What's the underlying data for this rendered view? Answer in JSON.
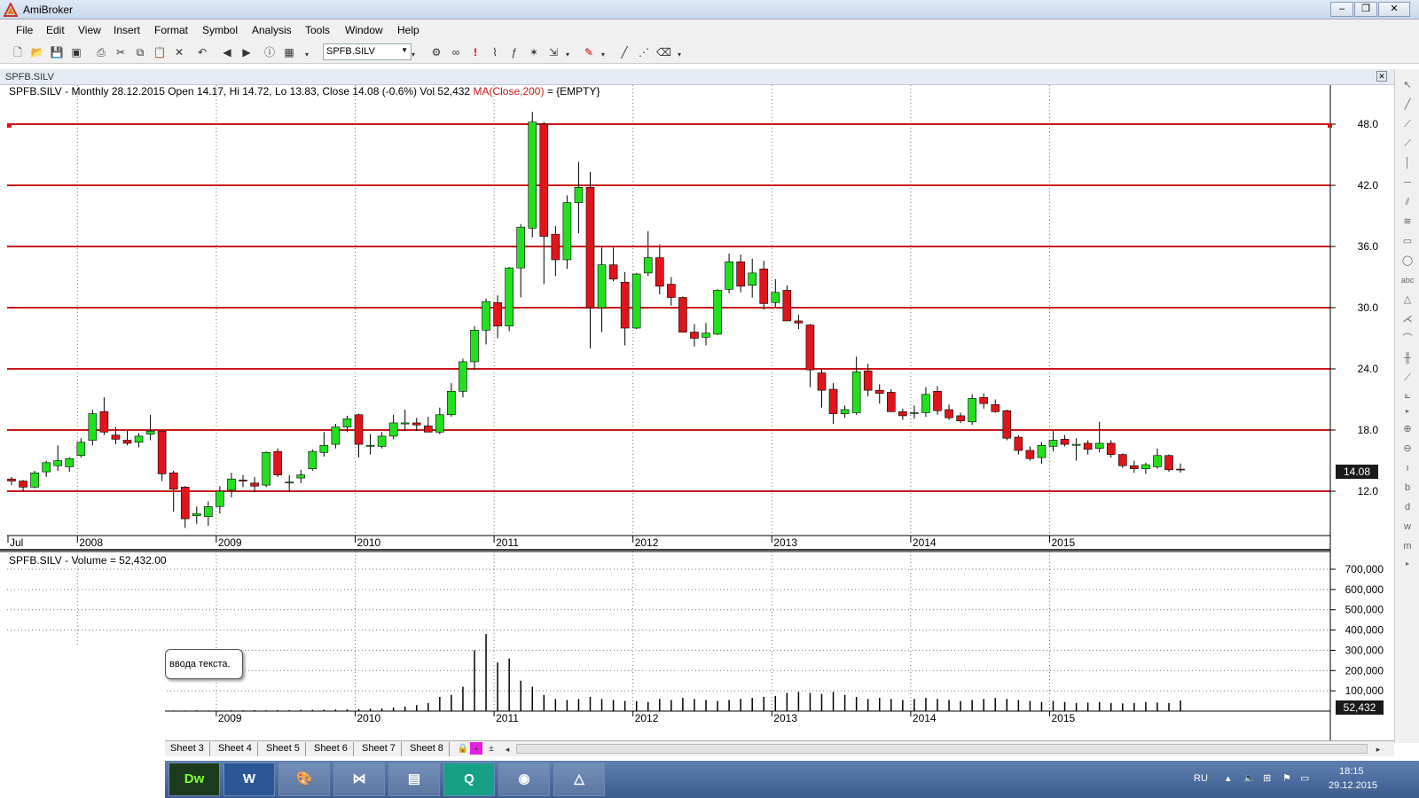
{
  "app": {
    "title": "AmiBroker"
  },
  "window_controls": {
    "minimize": "–",
    "restore": "❐",
    "close": "✕"
  },
  "menu": [
    "File",
    "Edit",
    "View",
    "Insert",
    "Format",
    "Symbol",
    "Analysis",
    "Tools",
    "Window",
    "Help"
  ],
  "toolbar": {
    "symbol": "SPFB.SILV"
  },
  "chart_window": {
    "title": "SPFB.SILV"
  },
  "price_pane": {
    "header_main": "SPFB.SILV - Monthly 28.12.2015 Open 14.17, Hi 14.72, Lo 13.83, Close 14.08 (-0.6%) Vol 52,432",
    "header_ma": "MA(Close,200)",
    "header_tail": " = {EMPTY}",
    "last_price_label": "14.08"
  },
  "volume_pane": {
    "header": "SPFB.SILV - Volume = 52,432.00",
    "last_volume_label": "52,432"
  },
  "tooltip": {
    "text": "ввода текста."
  },
  "sheets": [
    "Sheet 3",
    "Sheet 4",
    "Sheet 5",
    "Sheet 6",
    "Sheet 7",
    "Sheet 8"
  ],
  "taskbar": {
    "apps": [
      "Dw",
      "W",
      "",
      "",
      "",
      "Q",
      "",
      ""
    ],
    "language": "RU",
    "time": "18:15",
    "date": "29.12.2015"
  },
  "colors": {
    "up": "#22e01e",
    "down": "#e0141a",
    "hline": "#c8181c",
    "accent_bg": "#1a1a1a"
  },
  "chart_data": [
    {
      "type": "candlestick",
      "title": "SPFB.SILV - Monthly",
      "x_ticks": [
        "Jul",
        "2008",
        "2009",
        "2010",
        "2011",
        "2012",
        "2013",
        "2014",
        "2015"
      ],
      "y_ticks": [
        "48.0",
        "42.0",
        "36.0",
        "30.0",
        "24.0",
        "18.0",
        "12.0"
      ],
      "ylim": [
        6.0,
        50.0
      ],
      "horizontal_lines": [
        48.0,
        42.0,
        36.0,
        30.0,
        24.0,
        18.0,
        12.0
      ],
      "candles": [
        [
          13.2,
          13.4,
          12.6,
          13.0
        ],
        [
          13.0,
          13.1,
          12.0,
          12.4
        ],
        [
          12.4,
          14.0,
          12.3,
          13.8
        ],
        [
          13.9,
          15.0,
          13.4,
          14.8
        ],
        [
          14.5,
          16.5,
          14.0,
          15.0
        ],
        [
          14.4,
          15.3,
          13.9,
          15.2
        ],
        [
          15.5,
          17.2,
          15.3,
          16.8
        ],
        [
          17.0,
          20.0,
          16.5,
          19.6
        ],
        [
          19.8,
          21.2,
          17.5,
          17.8
        ],
        [
          17.5,
          18.3,
          16.6,
          17.1
        ],
        [
          17.0,
          18.0,
          16.5,
          16.7
        ],
        [
          16.8,
          17.7,
          16.3,
          17.4
        ],
        [
          17.6,
          19.5,
          17.0,
          17.9
        ],
        [
          17.9,
          18.0,
          13.0,
          13.7
        ],
        [
          13.8,
          14.0,
          10.0,
          12.2
        ],
        [
          12.4,
          12.5,
          8.4,
          9.3
        ],
        [
          9.6,
          10.5,
          8.8,
          9.8
        ],
        [
          9.5,
          11.0,
          8.6,
          10.5
        ],
        [
          10.5,
          12.5,
          9.8,
          12.0
        ],
        [
          12.1,
          13.8,
          11.4,
          13.2
        ],
        [
          13.1,
          13.6,
          12.4,
          13.0
        ],
        [
          12.8,
          13.4,
          11.9,
          12.5
        ],
        [
          12.6,
          15.9,
          12.4,
          15.8
        ],
        [
          15.9,
          16.2,
          13.4,
          13.6
        ],
        [
          12.8,
          13.6,
          11.9,
          12.9
        ],
        [
          13.3,
          14.1,
          12.8,
          13.6
        ],
        [
          14.2,
          16.1,
          14.0,
          15.9
        ],
        [
          15.8,
          17.8,
          15.4,
          16.5
        ],
        [
          16.6,
          18.6,
          16.2,
          18.3
        ],
        [
          18.3,
          19.4,
          17.8,
          19.1
        ],
        [
          19.5,
          19.6,
          15.3,
          16.6
        ],
        [
          16.4,
          17.6,
          15.6,
          16.5
        ],
        [
          16.4,
          17.8,
          16.2,
          17.4
        ],
        [
          17.4,
          19.5,
          17.1,
          18.7
        ],
        [
          18.6,
          20.0,
          17.9,
          18.7
        ],
        [
          18.7,
          19.2,
          17.9,
          18.5
        ],
        [
          18.4,
          19.3,
          17.8,
          17.8
        ],
        [
          17.8,
          20.2,
          17.6,
          19.5
        ],
        [
          19.5,
          22.6,
          19.3,
          21.8
        ],
        [
          21.8,
          25.0,
          21.2,
          24.7
        ],
        [
          24.7,
          28.2,
          23.9,
          27.8
        ],
        [
          27.8,
          30.9,
          26.4,
          30.6
        ],
        [
          30.5,
          31.2,
          27.0,
          28.2
        ],
        [
          28.2,
          34.0,
          27.7,
          33.9
        ],
        [
          33.9,
          38.2,
          31.0,
          37.9
        ],
        [
          37.8,
          49.2,
          36.9,
          48.2
        ],
        [
          48.0,
          48.2,
          32.3,
          37.0
        ],
        [
          37.2,
          38.0,
          33.1,
          34.7
        ],
        [
          34.7,
          41.0,
          33.8,
          40.3
        ],
        [
          40.3,
          44.3,
          37.3,
          41.8
        ],
        [
          41.8,
          43.3,
          26.0,
          30.0
        ],
        [
          30.0,
          35.9,
          27.6,
          34.2
        ],
        [
          34.2,
          35.9,
          32.6,
          32.8
        ],
        [
          32.5,
          33.5,
          26.3,
          28.0
        ],
        [
          28.0,
          33.4,
          27.9,
          33.3
        ],
        [
          33.4,
          37.5,
          33.1,
          34.9
        ],
        [
          34.9,
          36.2,
          31.3,
          32.1
        ],
        [
          32.3,
          33.0,
          30.2,
          31.0
        ],
        [
          31.0,
          31.1,
          27.6,
          27.6
        ],
        [
          27.6,
          28.4,
          26.2,
          27.0
        ],
        [
          27.1,
          28.5,
          26.3,
          27.5
        ],
        [
          27.4,
          31.8,
          27.3,
          31.7
        ],
        [
          31.8,
          35.3,
          31.4,
          34.5
        ],
        [
          34.5,
          35.2,
          31.5,
          32.1
        ],
        [
          32.2,
          34.8,
          31.0,
          33.4
        ],
        [
          33.8,
          34.6,
          29.8,
          30.4
        ],
        [
          30.5,
          32.8,
          30.0,
          31.5
        ],
        [
          31.7,
          32.2,
          28.7,
          28.7
        ],
        [
          28.7,
          29.3,
          27.9,
          28.5
        ],
        [
          28.3,
          28.4,
          22.2,
          23.9
        ],
        [
          23.6,
          24.0,
          20.2,
          21.9
        ],
        [
          22.0,
          22.6,
          18.6,
          19.6
        ],
        [
          19.6,
          20.4,
          19.2,
          20.0
        ],
        [
          19.7,
          25.2,
          19.5,
          23.7
        ],
        [
          23.8,
          24.5,
          21.3,
          21.9
        ],
        [
          21.9,
          22.5,
          20.6,
          21.6
        ],
        [
          21.7,
          22.0,
          19.8,
          19.8
        ],
        [
          19.8,
          20.1,
          19.0,
          19.4
        ],
        [
          19.7,
          20.4,
          19.1,
          19.7
        ],
        [
          19.7,
          22.2,
          19.3,
          21.5
        ],
        [
          21.8,
          22.3,
          19.5,
          19.9
        ],
        [
          20.0,
          20.5,
          19.0,
          19.2
        ],
        [
          19.4,
          19.7,
          18.7,
          18.9
        ],
        [
          18.8,
          21.5,
          18.5,
          21.1
        ],
        [
          21.2,
          21.6,
          20.1,
          20.6
        ],
        [
          20.5,
          21.0,
          19.7,
          19.8
        ],
        [
          19.9,
          20.0,
          17.0,
          17.2
        ],
        [
          17.3,
          17.5,
          15.6,
          16.0
        ],
        [
          16.0,
          16.4,
          15.0,
          15.2
        ],
        [
          15.3,
          16.8,
          14.7,
          16.5
        ],
        [
          16.4,
          17.9,
          15.9,
          17.0
        ],
        [
          17.1,
          17.5,
          16.4,
          16.6
        ],
        [
          16.5,
          17.2,
          15.0,
          16.6
        ],
        [
          16.7,
          17.0,
          15.6,
          16.1
        ],
        [
          16.2,
          18.8,
          15.8,
          16.7
        ],
        [
          16.7,
          17.0,
          15.3,
          15.6
        ],
        [
          15.6,
          15.7,
          14.3,
          14.5
        ],
        [
          14.5,
          15.0,
          13.8,
          14.2
        ],
        [
          14.2,
          14.8,
          13.7,
          14.6
        ],
        [
          14.4,
          16.2,
          14.2,
          15.5
        ],
        [
          15.5,
          15.6,
          13.9,
          14.1
        ],
        [
          14.17,
          14.72,
          13.83,
          14.08
        ]
      ]
    },
    {
      "type": "bar",
      "title": "SPFB.SILV - Volume",
      "x_ticks": [
        "2009",
        "2010",
        "2011",
        "2012",
        "2013",
        "2014",
        "2015"
      ],
      "y_ticks": [
        "700,000",
        "600,000",
        "500,000",
        "400,000",
        "300,000",
        "200,000",
        "100,000"
      ],
      "ylim": [
        0,
        700000
      ],
      "values": [
        2000,
        3000,
        2000,
        2000,
        3000,
        2000,
        2000,
        3000,
        2000,
        3000,
        3000,
        2000,
        3000,
        3000,
        4000,
        3000,
        3000,
        4000,
        4000,
        5000,
        4000,
        5000,
        5000,
        6000,
        6000,
        7000,
        8000,
        9000,
        10000,
        12000,
        14000,
        18000,
        22000,
        30000,
        40000,
        70000,
        80000,
        120000,
        300000,
        380000,
        240000,
        260000,
        150000,
        120000,
        80000,
        60000,
        55000,
        60000,
        70000,
        60000,
        55000,
        50000,
        50000,
        45000,
        60000,
        55000,
        65000,
        60000,
        55000,
        50000,
        55000,
        60000,
        65000,
        70000,
        75000,
        90000,
        95000,
        90000,
        85000,
        95000,
        80000,
        70000,
        60000,
        65000,
        60000,
        55000,
        60000,
        65000,
        60000,
        55000,
        50000,
        55000,
        60000,
        65000,
        60000,
        55000,
        50000,
        45000,
        50000,
        45000,
        40000,
        42000,
        45000,
        40000,
        38000,
        40000,
        45000,
        42000,
        40000,
        52432
      ]
    }
  ]
}
